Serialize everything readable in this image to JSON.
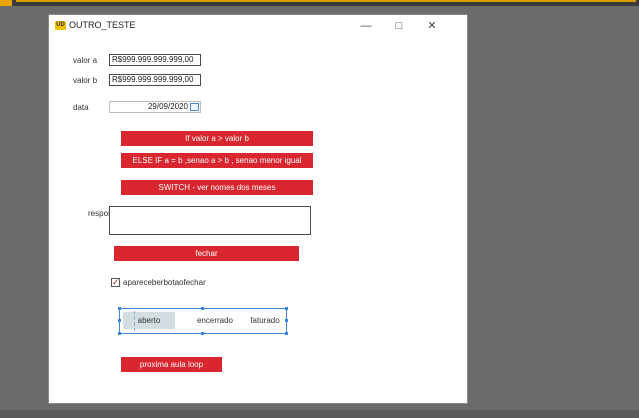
{
  "window": {
    "title": "OUTRO_TESTE",
    "icon_text": "UD"
  },
  "form": {
    "valor_a": {
      "label": "valor a",
      "value": "R$999.999.999.999,00"
    },
    "valor_b": {
      "label": "valor b",
      "value": "R$999.999.999.999,00"
    },
    "data": {
      "label": "data",
      "value": "29/09/2020"
    },
    "resposta_label": "respos"
  },
  "buttons": {
    "if_btn": "If valor a > valor b",
    "else_if_btn": "ELSE IF a = b ,senao a > b , senao menor igual",
    "switch_btn": "SWITCH - ver nomes dos meses",
    "fechar_btn": "fechar",
    "proxima_btn": "proxima aula loop"
  },
  "checkbox": {
    "label": "apareceberbotaofechar",
    "checked": true
  },
  "segmented": {
    "items": [
      "aberto",
      "encerrado",
      "faturado"
    ],
    "selected": "aberto"
  },
  "colors": {
    "accent": "#d9262f",
    "selection": "#3b86d6"
  }
}
